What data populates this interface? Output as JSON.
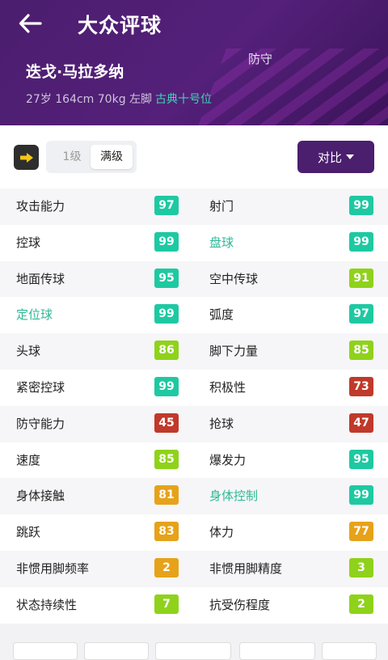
{
  "header": {
    "title": "大众评球",
    "player_name": "迭戈·马拉多纳",
    "position": "防守",
    "meta": "27岁 164cm 70kg 左脚",
    "role": "古典十号位"
  },
  "toolbar": {
    "level_options": [
      "1级",
      "满级"
    ],
    "selected_level": "满级",
    "compare_label": "对比"
  },
  "colors": {
    "header_bg": "#4b1e6e",
    "teal": "#1ec9a2",
    "green": "#8fd21b",
    "orange": "#e6a21a",
    "red": "#c0392b"
  },
  "stats": [
    [
      {
        "label": "攻击能力",
        "value": "97",
        "color": "teal",
        "highlight": false
      },
      {
        "label": "射门",
        "value": "99",
        "color": "teal",
        "highlight": false
      }
    ],
    [
      {
        "label": "控球",
        "value": "99",
        "color": "teal",
        "highlight": false
      },
      {
        "label": "盘球",
        "value": "99",
        "color": "teal",
        "highlight": true
      }
    ],
    [
      {
        "label": "地面传球",
        "value": "95",
        "color": "teal",
        "highlight": false
      },
      {
        "label": "空中传球",
        "value": "91",
        "color": "green",
        "highlight": false
      }
    ],
    [
      {
        "label": "定位球",
        "value": "99",
        "color": "teal",
        "highlight": true
      },
      {
        "label": "弧度",
        "value": "97",
        "color": "teal",
        "highlight": false
      }
    ],
    [
      {
        "label": "头球",
        "value": "86",
        "color": "green",
        "highlight": false
      },
      {
        "label": "脚下力量",
        "value": "85",
        "color": "green",
        "highlight": false
      }
    ],
    [
      {
        "label": "紧密控球",
        "value": "99",
        "color": "teal",
        "highlight": false
      },
      {
        "label": "积极性",
        "value": "73",
        "color": "red",
        "highlight": false
      }
    ],
    [
      {
        "label": "防守能力",
        "value": "45",
        "color": "red",
        "highlight": false
      },
      {
        "label": "抢球",
        "value": "47",
        "color": "red",
        "highlight": false
      }
    ],
    [
      {
        "label": "速度",
        "value": "85",
        "color": "green",
        "highlight": false
      },
      {
        "label": "爆发力",
        "value": "95",
        "color": "teal",
        "highlight": false
      }
    ],
    [
      {
        "label": "身体接触",
        "value": "81",
        "color": "orange",
        "highlight": false
      },
      {
        "label": "身体控制",
        "value": "99",
        "color": "teal",
        "highlight": true
      }
    ],
    [
      {
        "label": "跳跃",
        "value": "83",
        "color": "orange",
        "highlight": false
      },
      {
        "label": "体力",
        "value": "77",
        "color": "orange",
        "highlight": false
      }
    ],
    [
      {
        "label": "非惯用脚频率",
        "value": "2",
        "color": "orange",
        "highlight": false
      },
      {
        "label": "非惯用脚精度",
        "value": "3",
        "color": "green",
        "highlight": false
      }
    ],
    [
      {
        "label": "状态持续性",
        "value": "7",
        "color": "green",
        "highlight": false
      },
      {
        "label": "抗受伤程度",
        "value": "2",
        "color": "green",
        "highlight": false
      }
    ]
  ]
}
